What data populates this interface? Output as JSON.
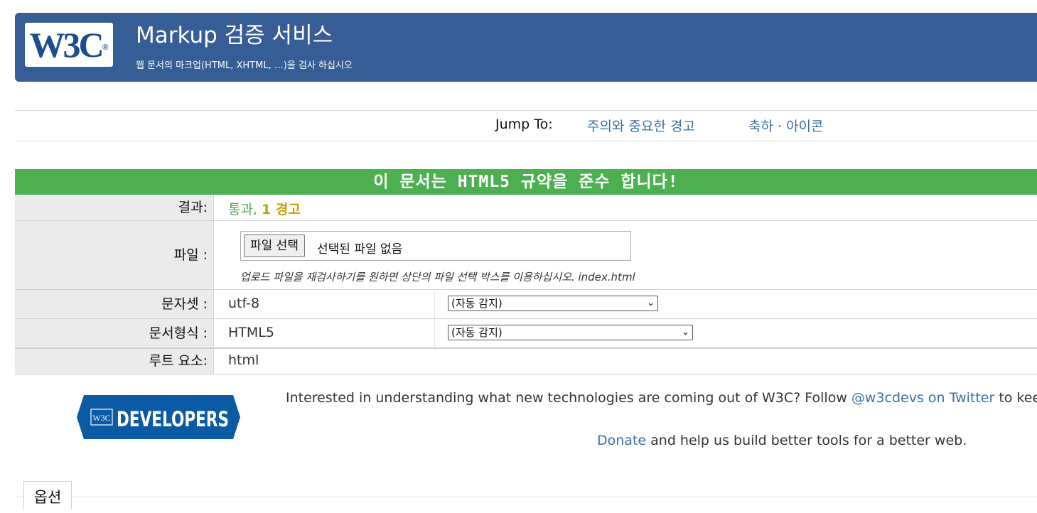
{
  "banner": {
    "logo_text": "W3C",
    "logo_mark": "®",
    "title": "Markup 검증 서비스",
    "subtitle": "웹 문서의 마크업(HTML, XHTML, …)을 검사 하십시오"
  },
  "jump": {
    "label": "Jump To:",
    "links": [
      "주의와 중요한 경고",
      "축하 · 아이콘"
    ]
  },
  "result_banner": "이 문서는 HTML5 규약을 준수 합니다!",
  "rows": {
    "result": {
      "label": "결과:",
      "pass": "통과,",
      "warning": "1 경고"
    },
    "file": {
      "label": "파일 :",
      "button": "파일 선택",
      "status": "선택된 파일 없음",
      "hint": "업로드 파일을 재검사하기를 원하면 상단의 파일 선택 박스를 이용하십시오. index.html"
    },
    "charset": {
      "label": "문자셋 :",
      "value": "utf-8",
      "select": "(자동 감지)"
    },
    "doctype": {
      "label": "문서형식 :",
      "value": "HTML5",
      "select": "(자동 감지)"
    },
    "root": {
      "label": "루트 요소:",
      "value": "html"
    }
  },
  "developers_logo": {
    "badge": "W3C",
    "text": "DEVELOPERS"
  },
  "promo": {
    "text_before": "Interested in understanding what new technologies are coming out of W3C? Follow ",
    "link": "@w3cdevs on Twitter",
    "text_after": " to keep"
  },
  "donate": {
    "link": "Donate",
    "text": " and help us build better tools for a better web."
  },
  "options_tab": "옵션",
  "colors": {
    "banner": "#365d95",
    "success": "#4caf50",
    "link": "#3b6ea5",
    "pass_text": "#4caf50",
    "warning_text": "#c8a000"
  },
  "icons": [
    "chevron-down-icon",
    "w3c-logo",
    "w3c-developers-logo"
  ]
}
